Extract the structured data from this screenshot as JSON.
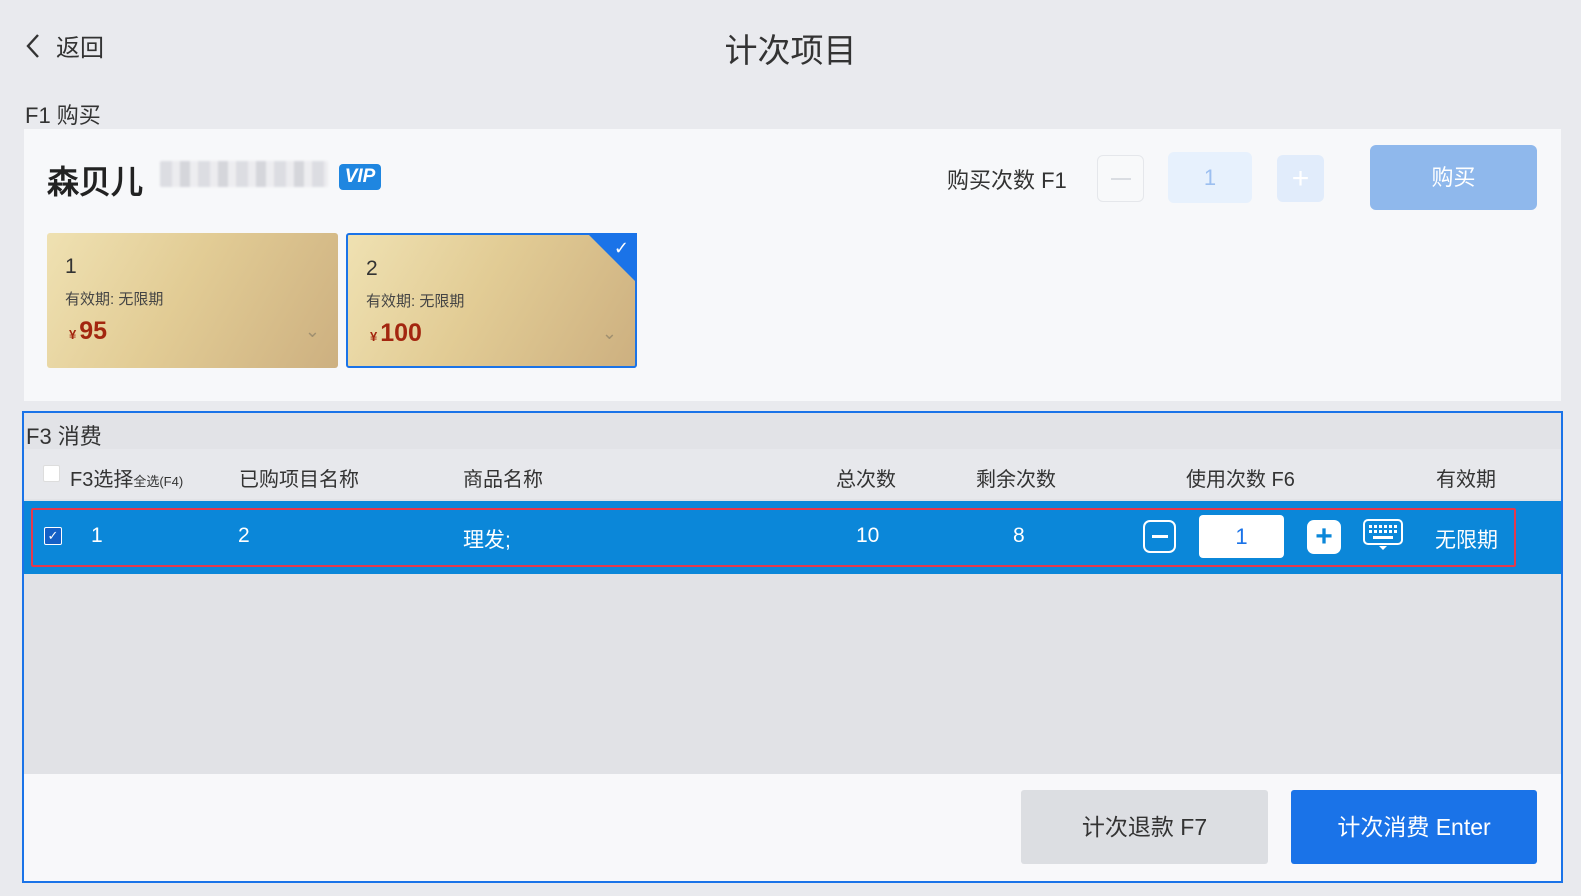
{
  "header": {
    "back_label": "返回",
    "title": "计次项目"
  },
  "buy_section": {
    "label": "F1 购买",
    "member_name": "森贝儿",
    "vip_badge": "VIP",
    "qty_label": "购买次数 F1",
    "qty_value": "1",
    "buy_button": "购买",
    "cards": [
      {
        "name": "1",
        "validity": "有效期: 无限期",
        "currency": "¥",
        "price": "95",
        "selected": false
      },
      {
        "name": "2",
        "validity": "有效期: 无限期",
        "currency": "¥",
        "price": "100",
        "selected": true
      }
    ]
  },
  "consume_section": {
    "label": "F3 消费",
    "columns": {
      "select": "F3选择",
      "select_all": "全选(F4)",
      "purchased_name": "已购项目名称",
      "product_name": "商品名称",
      "total": "总次数",
      "remaining": "剩余次数",
      "use_count": "使用次数 F6",
      "validity": "有效期"
    },
    "rows": [
      {
        "index": "1",
        "purchased_name": "2",
        "product_name": "理发;",
        "total": "10",
        "remaining": "8",
        "use_count": "1",
        "validity": "无限期",
        "checked": true
      }
    ],
    "refund_button": "计次退款 F7",
    "consume_button": "计次消费 Enter"
  },
  "colors": {
    "accent": "#1a73e8",
    "row_highlight": "#0b87d9",
    "price": "#a3260f"
  }
}
